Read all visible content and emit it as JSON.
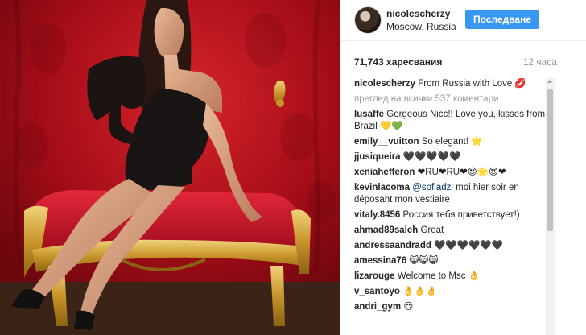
{
  "post": {
    "username": "nicolescherzy",
    "location": "Moscow, Russia",
    "follow_label": "Последване",
    "likes": "71,743 харесвания",
    "time": "12 часа"
  },
  "comments": {
    "caption_user": "nicolescherzy",
    "caption_text": "From Russia with Love 💋",
    "view_all": "преглед на всички 537 коментари",
    "items": [
      {
        "user": "lusaffe",
        "text": "Gorgeous Nicc!! Love you, kisses from Brazil 💛💚"
      },
      {
        "user": "emily__vuitton",
        "text": "So elegant! 🌟"
      },
      {
        "user": "jjusiqueira",
        "text": "🖤🖤🖤🖤🖤"
      },
      {
        "user": "xeniahefferon",
        "text": "❤RU❤RU❤😍🌟😍❤"
      },
      {
        "user": "kevinlacoma",
        "mention": "@sofiadzl",
        "text": "moi hier soir en déposant mon vestiaire"
      },
      {
        "user": "vitaly.8456",
        "text": "Россия тебя приветствует!)"
      },
      {
        "user": "ahmad89saleh",
        "text": "Great"
      },
      {
        "user": "andressaandradd",
        "text": "🖤🖤🖤🖤🖤🖤"
      },
      {
        "user": "amessina76",
        "text": "😸😸😸"
      },
      {
        "user": "lizarouge",
        "text": "Welcome to Msc 👌"
      },
      {
        "user": "v_santoyo",
        "text": "👌👌👌"
      },
      {
        "user": "andri_gym",
        "text": "😍"
      }
    ]
  },
  "colors": {
    "accent": "#3897f0",
    "backdrop_red": "#b0101a",
    "gold": "#d4a93c"
  }
}
